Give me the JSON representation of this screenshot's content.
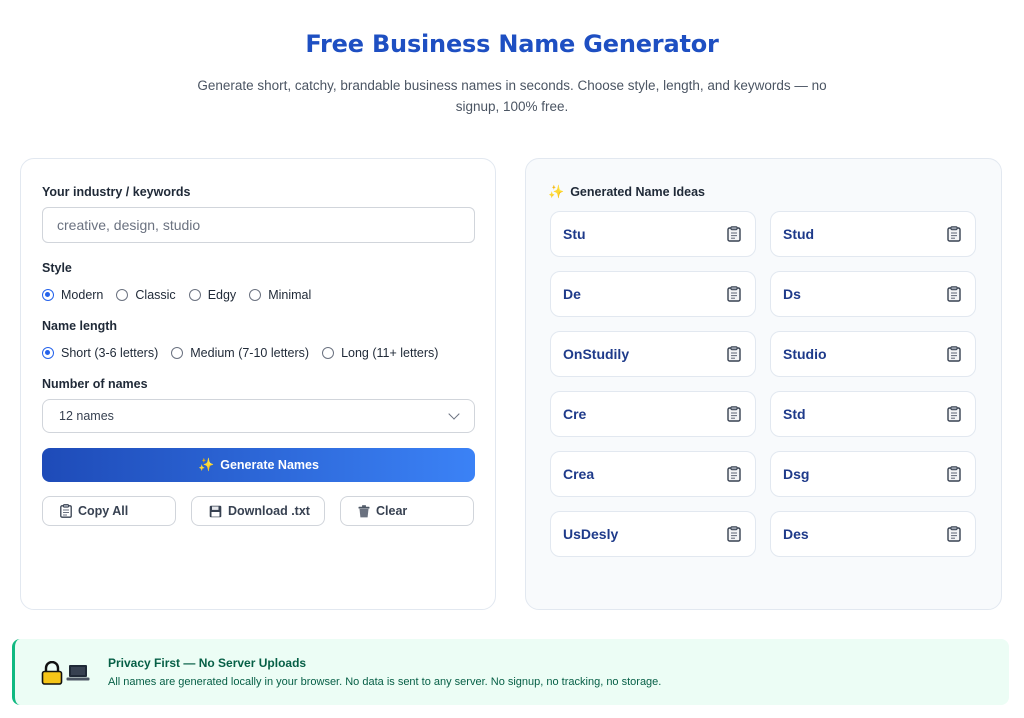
{
  "header": {
    "title": "Free Business Name Generator",
    "subtitle": "Generate short, catchy, brandable business names in seconds. Choose style, length, and keywords — no signup, 100% free."
  },
  "form": {
    "keywords_label": "Your industry / keywords",
    "keywords_placeholder": "creative, design, studio",
    "keywords_value": "",
    "style_label": "Style",
    "style_options": [
      "Modern",
      "Classic",
      "Edgy",
      "Minimal"
    ],
    "style_selected": "Modern",
    "length_label": "Name length",
    "length_options": [
      "Short (3-6 letters)",
      "Medium (7-10 letters)",
      "Long (11+ letters)"
    ],
    "length_selected": "Short (3-6 letters)",
    "count_label": "Number of names",
    "count_value": "12 names",
    "generate_label": "Generate Names",
    "copy_all_label": "Copy All",
    "download_label": "Download .txt",
    "clear_label": "Clear"
  },
  "results": {
    "title": "Generated Name Ideas",
    "names": [
      "Stu",
      "Stud",
      "De",
      "Ds",
      "OnStudily",
      "Studio",
      "Cre",
      "Std",
      "Crea",
      "Dsg",
      "UsDesly",
      "Des"
    ]
  },
  "privacy": {
    "title": "Privacy First — No Server Uploads",
    "text": "All names are generated locally in your browser. No data is sent to any server. No signup, no tracking, no storage."
  },
  "icons": {
    "sparkle": "sparkle-icon",
    "clipboard": "clipboard-icon",
    "floppy": "floppy-disk-icon",
    "trash": "trash-icon",
    "lock": "lock-icon",
    "laptop": "laptop-icon"
  },
  "colors": {
    "accent": "#1e4fc2",
    "button_gradient_start": "#1e4bb8",
    "button_gradient_end": "#3b82f6",
    "name_text": "#1e3a8a",
    "privacy_bg": "#ecfdf5",
    "privacy_text": "#065f46"
  }
}
